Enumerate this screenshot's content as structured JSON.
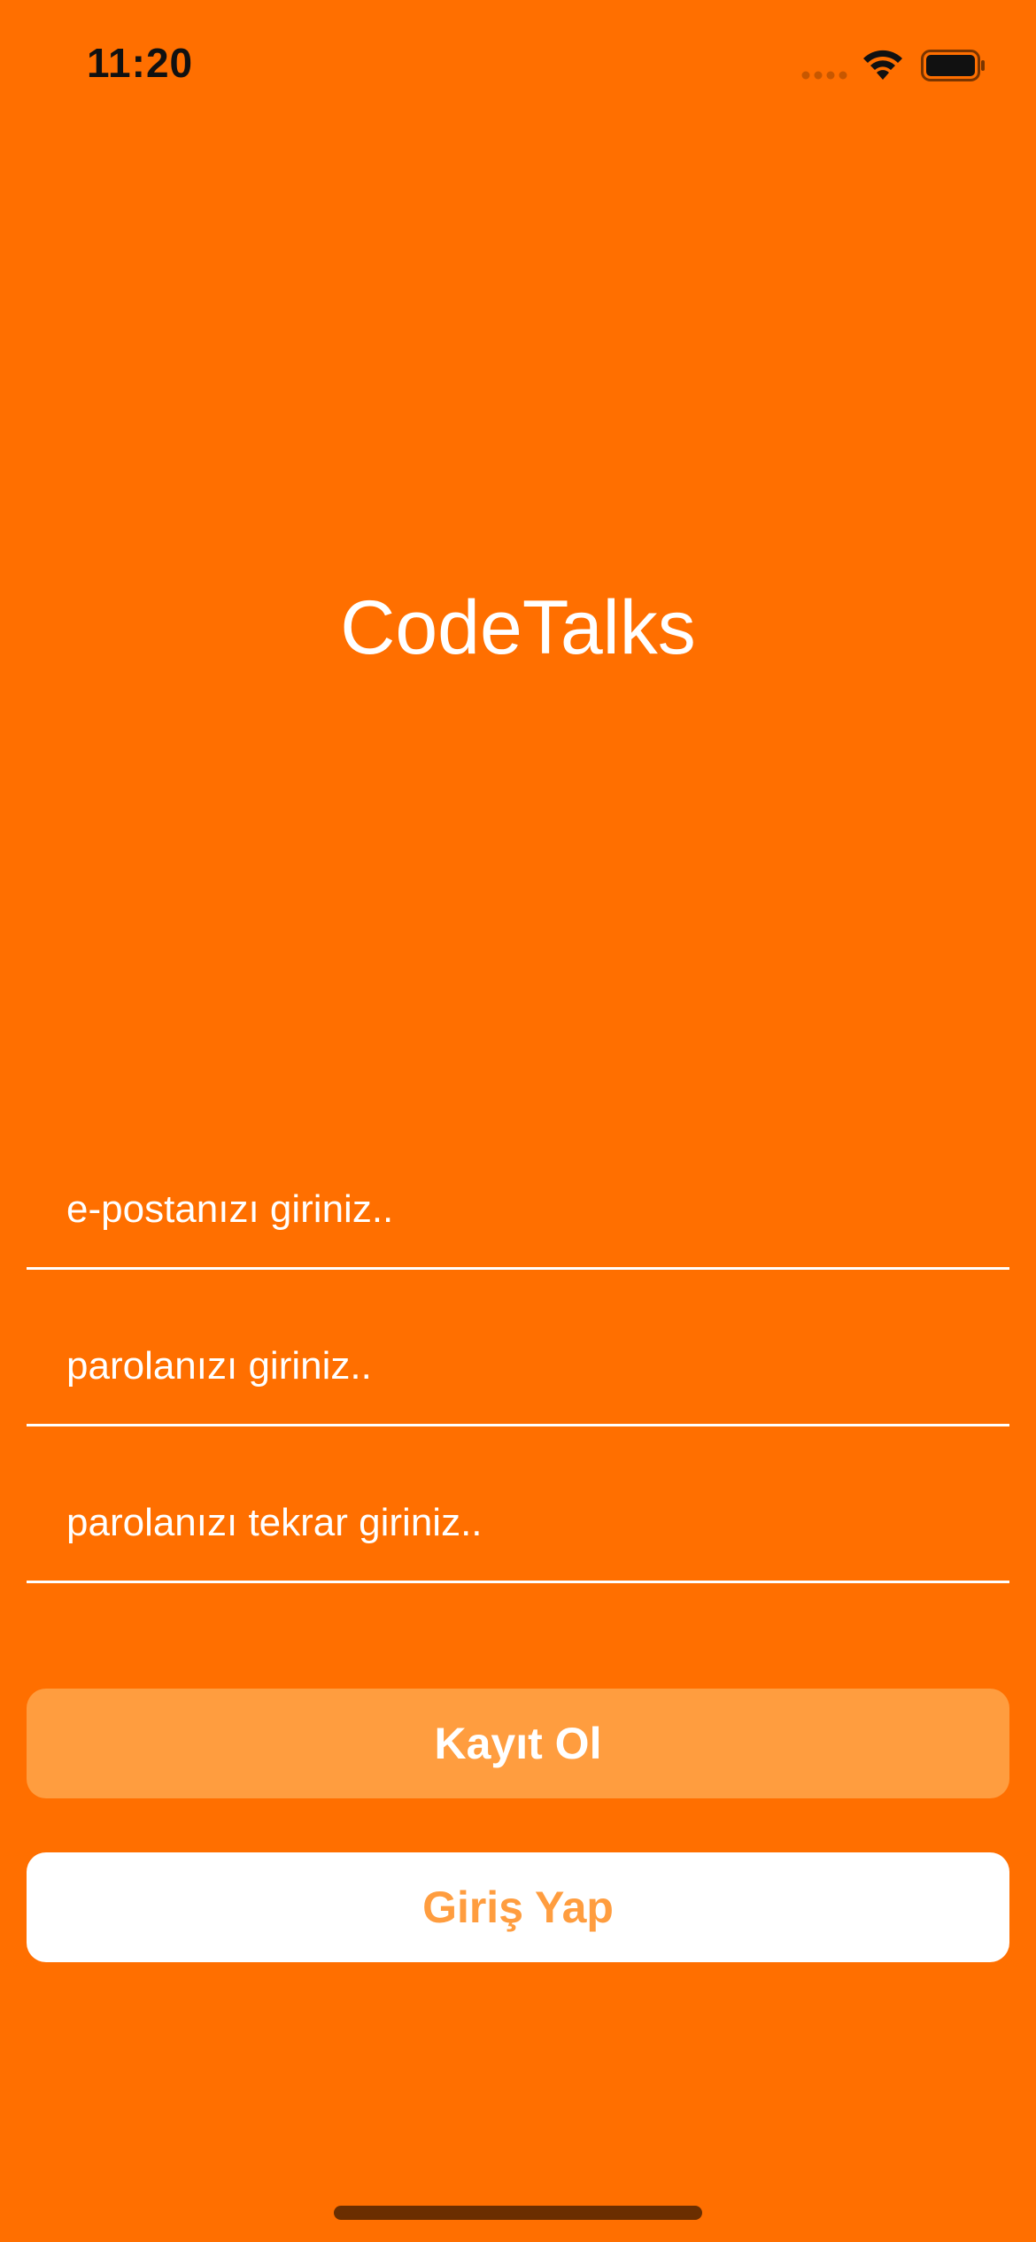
{
  "status_bar": {
    "time": "11:20",
    "icons": [
      "cellular-signal-icon",
      "wifi-icon",
      "battery-icon"
    ]
  },
  "app": {
    "title": "CodeTalks"
  },
  "form": {
    "email_placeholder": "e-postanızı giriniz..",
    "password_placeholder": "parolanızı giriniz..",
    "password_repeat_placeholder": "parolanızı tekrar giriniz.."
  },
  "buttons": {
    "register_label": "Kayıt Ol",
    "login_label": "Giriş Yap"
  },
  "colors": {
    "background": "#FF6F00",
    "register_button": "#FF9D3F",
    "login_button_text": "#FF9D3F",
    "text": "#FFFFFF"
  }
}
